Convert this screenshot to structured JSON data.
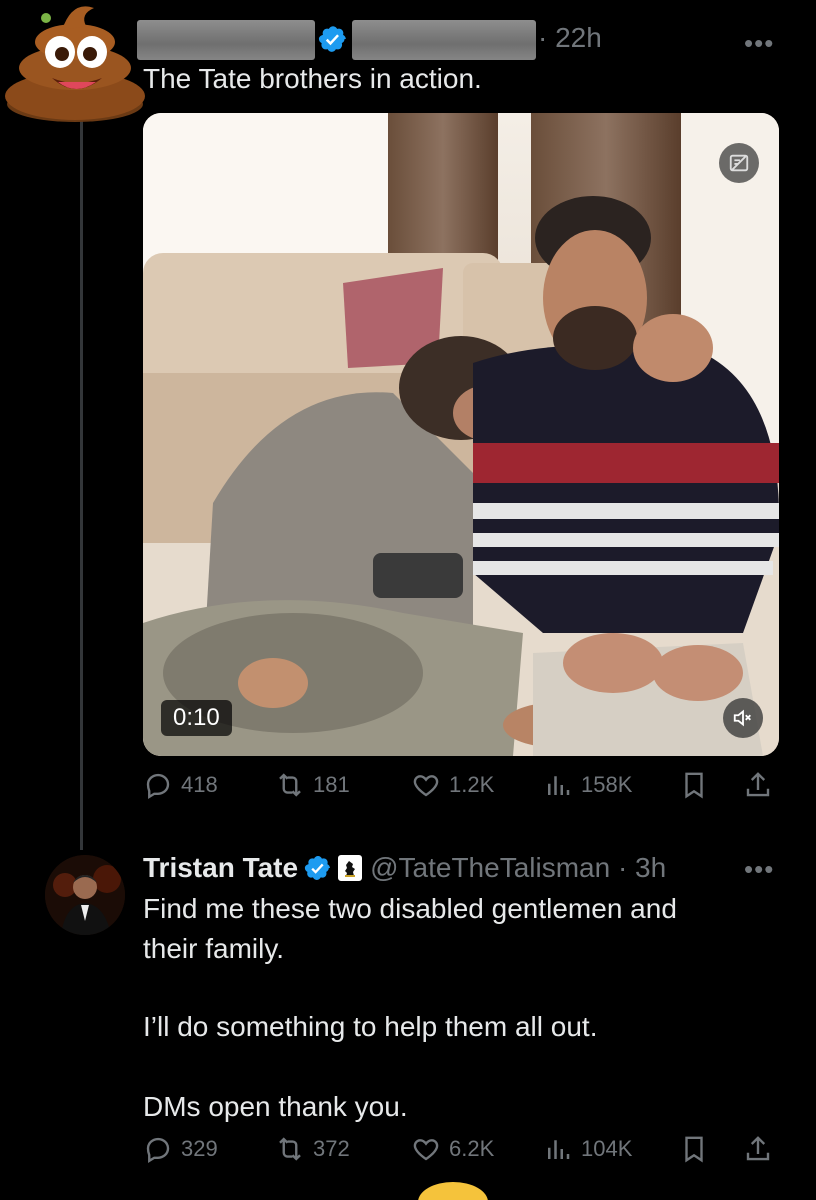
{
  "tweet": {
    "time": "· 22h",
    "text": "The Tate brothers in action.",
    "media": {
      "duration": "0:10"
    },
    "stats": {
      "replies": "418",
      "reposts": "181",
      "likes": "1.2K",
      "views": "158K"
    }
  },
  "reply": {
    "name": "Tristan Tate",
    "handle_time": "@TateTheTalisman · 3h",
    "lines": [
      "Find me these two disabled gentlemen and",
      "their family.",
      "I’ll do something to help them all out.",
      "DMs open thank you."
    ],
    "stats": {
      "replies": "329",
      "reposts": "372",
      "likes": "6.2K",
      "views": "104K"
    }
  },
  "icons": {
    "more": "more-horizontal-icon",
    "verified": "verified-badge-icon",
    "reply": "reply-icon",
    "repost": "repost-icon",
    "like": "heart-icon",
    "views": "views-icon",
    "bookmark": "bookmark-icon",
    "share": "share-icon",
    "mute": "muted-speaker-icon",
    "content_warning": "content-disclosure-icon"
  },
  "colors": {
    "background": "#000000",
    "text": "#e7e9ea",
    "secondary": "#71767b",
    "verified": "#1d9bf0"
  }
}
